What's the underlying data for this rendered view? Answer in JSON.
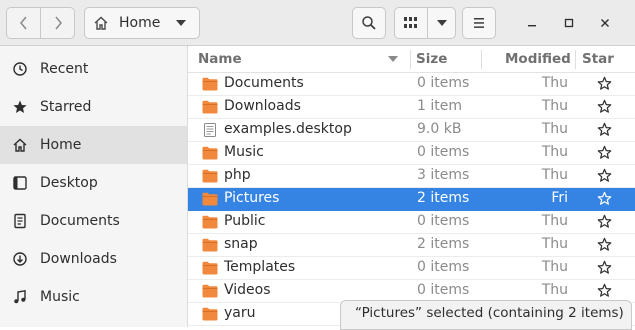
{
  "header": {
    "location_label": "Home",
    "icons": {
      "back": "chevron-left-icon",
      "forward": "chevron-right-icon",
      "home": "home-icon",
      "path_dropdown": "dropdown-arrow-icon",
      "search": "search-icon",
      "view": "grid-view-icon",
      "view_options": "dropdown-arrow-icon",
      "menu": "hamburger-menu-icon",
      "minimize": "minimize-icon",
      "maximize": "maximize-icon",
      "close": "close-icon"
    }
  },
  "sidebar": {
    "items": [
      {
        "label": "Recent",
        "icon": "clock-icon"
      },
      {
        "label": "Starred",
        "icon": "star-icon"
      },
      {
        "label": "Home",
        "icon": "home-icon",
        "active": true
      },
      {
        "label": "Desktop",
        "icon": "desktop-icon"
      },
      {
        "label": "Documents",
        "icon": "document-icon"
      },
      {
        "label": "Downloads",
        "icon": "download-icon"
      },
      {
        "label": "Music",
        "icon": "music-icon"
      }
    ]
  },
  "columns": {
    "name": "Name",
    "size": "Size",
    "modified": "Modified",
    "star": "Star"
  },
  "files": [
    {
      "name": "Documents",
      "size": "0 items",
      "modified": "Thu",
      "type": "folder"
    },
    {
      "name": "Downloads",
      "size": "1 item",
      "modified": "Thu",
      "type": "folder"
    },
    {
      "name": "examples.desktop",
      "size": "9.0 kB",
      "modified": "Thu",
      "type": "file"
    },
    {
      "name": "Music",
      "size": "0 items",
      "modified": "Thu",
      "type": "folder"
    },
    {
      "name": "php",
      "size": "3 items",
      "modified": "Thu",
      "type": "folder"
    },
    {
      "name": "Pictures",
      "size": "2 items",
      "modified": "Fri",
      "type": "folder",
      "selected": true
    },
    {
      "name": "Public",
      "size": "0 items",
      "modified": "Thu",
      "type": "folder"
    },
    {
      "name": "snap",
      "size": "2 items",
      "modified": "Thu",
      "type": "folder"
    },
    {
      "name": "Templates",
      "size": "0 items",
      "modified": "Thu",
      "type": "folder"
    },
    {
      "name": "Videos",
      "size": "0 items",
      "modified": "Thu",
      "type": "folder"
    },
    {
      "name": "yaru",
      "size": "",
      "modified": "",
      "type": "folder"
    }
  ],
  "status": {
    "text": "“Pictures” selected  (containing 2 items)"
  },
  "colors": {
    "selection": "#3584e4",
    "folder": "#f0883e",
    "header_bg": "#ebebeb",
    "sidebar_bg": "#f5f5f5"
  }
}
